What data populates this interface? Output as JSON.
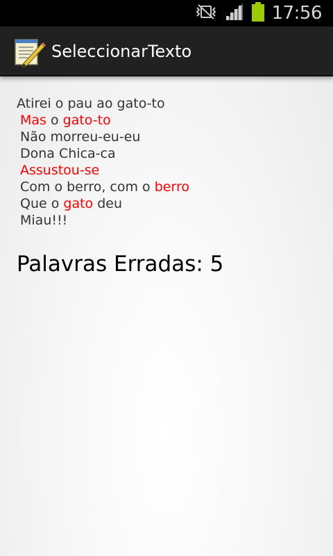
{
  "status_bar": {
    "time": "17:56",
    "icons": [
      "vibrate-icon",
      "signal-icon",
      "battery-icon"
    ],
    "battery_color": "#9ccc00"
  },
  "action_bar": {
    "title": "SeleccionarTexto",
    "icon": "notepad-pencil-icon"
  },
  "poem": {
    "line1": {
      "a": "Atirei o pau ao gato-to"
    },
    "line2": {
      "w1": "Mas",
      "b": " o ",
      "w2": "gato-to"
    },
    "line3": {
      "a": "Não morreu-eu-eu"
    },
    "line4": {
      "a": "Dona Chica-ca"
    },
    "line5": {
      "w1": "Assustou-se"
    },
    "line6": {
      "a": "Com o berro, com o ",
      "w1": "berro"
    },
    "line7": {
      "a": "Que o ",
      "w1": "gato",
      "b": " deu"
    },
    "line8": {
      "a": "Miau!!!"
    }
  },
  "highlight_color": "#ff0000",
  "summary": {
    "label": "Palavras Erradas: ",
    "count": "5"
  }
}
